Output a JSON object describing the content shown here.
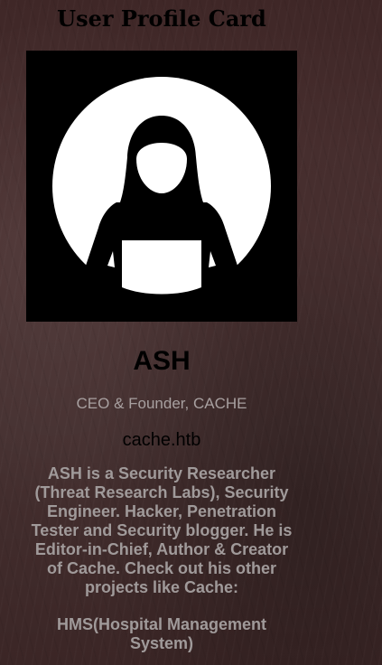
{
  "page": {
    "title": "User Profile Card"
  },
  "profile": {
    "avatar_icon": "hooded-hacker-icon",
    "name": "ASH",
    "role": "CEO & Founder, CACHE",
    "domain": "cache.htb",
    "bio": "ASH is a Security Researcher (Threat Research Labs), Security Engineer. Hacker, Penetration Tester and Security blogger. He is Editor-in-Chief, Author & Creator of Cache. Check out his other projects like Cache:",
    "project": "HMS(Hospital Management System)"
  },
  "colors": {
    "background": "#452e2e",
    "title": "#000000",
    "muted_text": "#a09a9a",
    "avatar_bg": "#000000",
    "avatar_fg": "#ffffff"
  }
}
